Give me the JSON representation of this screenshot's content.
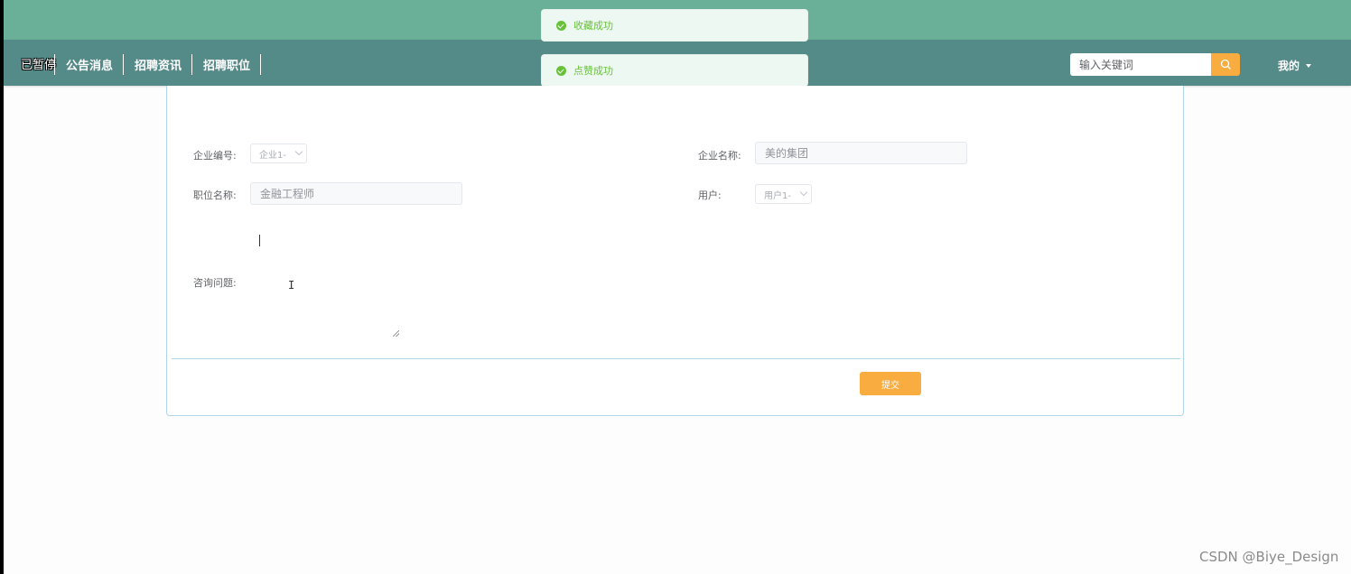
{
  "nav": {
    "logo": "已暂停",
    "items": [
      "公告消息",
      "招聘资讯",
      "招聘职位"
    ],
    "search_placeholder": "输入关键词",
    "user_menu": "我的"
  },
  "toasts": [
    {
      "text": "收藏成功",
      "type": "success"
    },
    {
      "text": "点赞成功",
      "type": "success"
    }
  ],
  "form": {
    "company_id_label": "企业编号:",
    "company_id_value": "企业1-",
    "company_name_label": "企业名称:",
    "company_name_value": "美的集团",
    "position_label": "职位名称:",
    "position_value": "金融工程师",
    "user_label": "用户:",
    "user_value": "用户1-",
    "question_label": "咨询问题:",
    "question_value": "",
    "submit_label": "提交"
  },
  "watermark": "CSDN @Biye_Design",
  "colors": {
    "top_strip": "#6ab098",
    "nav_bg": "#548a87",
    "accent": "#f9ac3f",
    "success": "#67c23a",
    "card_border": "#aed6e6"
  }
}
